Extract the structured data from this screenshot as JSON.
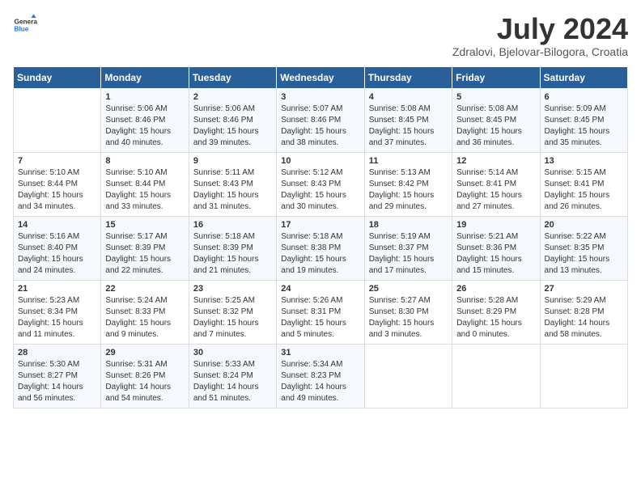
{
  "logo": {
    "text_general": "General",
    "text_blue": "Blue"
  },
  "header": {
    "month": "July 2024",
    "location": "Zdralovi, Bjelovar-Bilogora, Croatia"
  },
  "weekdays": [
    "Sunday",
    "Monday",
    "Tuesday",
    "Wednesday",
    "Thursday",
    "Friday",
    "Saturday"
  ],
  "weeks": [
    [
      {
        "day": "",
        "sunrise": "",
        "sunset": "",
        "daylight": ""
      },
      {
        "day": "1",
        "sunrise": "Sunrise: 5:06 AM",
        "sunset": "Sunset: 8:46 PM",
        "daylight": "Daylight: 15 hours and 40 minutes."
      },
      {
        "day": "2",
        "sunrise": "Sunrise: 5:06 AM",
        "sunset": "Sunset: 8:46 PM",
        "daylight": "Daylight: 15 hours and 39 minutes."
      },
      {
        "day": "3",
        "sunrise": "Sunrise: 5:07 AM",
        "sunset": "Sunset: 8:46 PM",
        "daylight": "Daylight: 15 hours and 38 minutes."
      },
      {
        "day": "4",
        "sunrise": "Sunrise: 5:08 AM",
        "sunset": "Sunset: 8:45 PM",
        "daylight": "Daylight: 15 hours and 37 minutes."
      },
      {
        "day": "5",
        "sunrise": "Sunrise: 5:08 AM",
        "sunset": "Sunset: 8:45 PM",
        "daylight": "Daylight: 15 hours and 36 minutes."
      },
      {
        "day": "6",
        "sunrise": "Sunrise: 5:09 AM",
        "sunset": "Sunset: 8:45 PM",
        "daylight": "Daylight: 15 hours and 35 minutes."
      }
    ],
    [
      {
        "day": "7",
        "sunrise": "Sunrise: 5:10 AM",
        "sunset": "Sunset: 8:44 PM",
        "daylight": "Daylight: 15 hours and 34 minutes."
      },
      {
        "day": "8",
        "sunrise": "Sunrise: 5:10 AM",
        "sunset": "Sunset: 8:44 PM",
        "daylight": "Daylight: 15 hours and 33 minutes."
      },
      {
        "day": "9",
        "sunrise": "Sunrise: 5:11 AM",
        "sunset": "Sunset: 8:43 PM",
        "daylight": "Daylight: 15 hours and 31 minutes."
      },
      {
        "day": "10",
        "sunrise": "Sunrise: 5:12 AM",
        "sunset": "Sunset: 8:43 PM",
        "daylight": "Daylight: 15 hours and 30 minutes."
      },
      {
        "day": "11",
        "sunrise": "Sunrise: 5:13 AM",
        "sunset": "Sunset: 8:42 PM",
        "daylight": "Daylight: 15 hours and 29 minutes."
      },
      {
        "day": "12",
        "sunrise": "Sunrise: 5:14 AM",
        "sunset": "Sunset: 8:41 PM",
        "daylight": "Daylight: 15 hours and 27 minutes."
      },
      {
        "day": "13",
        "sunrise": "Sunrise: 5:15 AM",
        "sunset": "Sunset: 8:41 PM",
        "daylight": "Daylight: 15 hours and 26 minutes."
      }
    ],
    [
      {
        "day": "14",
        "sunrise": "Sunrise: 5:16 AM",
        "sunset": "Sunset: 8:40 PM",
        "daylight": "Daylight: 15 hours and 24 minutes."
      },
      {
        "day": "15",
        "sunrise": "Sunrise: 5:17 AM",
        "sunset": "Sunset: 8:39 PM",
        "daylight": "Daylight: 15 hours and 22 minutes."
      },
      {
        "day": "16",
        "sunrise": "Sunrise: 5:18 AM",
        "sunset": "Sunset: 8:39 PM",
        "daylight": "Daylight: 15 hours and 21 minutes."
      },
      {
        "day": "17",
        "sunrise": "Sunrise: 5:18 AM",
        "sunset": "Sunset: 8:38 PM",
        "daylight": "Daylight: 15 hours and 19 minutes."
      },
      {
        "day": "18",
        "sunrise": "Sunrise: 5:19 AM",
        "sunset": "Sunset: 8:37 PM",
        "daylight": "Daylight: 15 hours and 17 minutes."
      },
      {
        "day": "19",
        "sunrise": "Sunrise: 5:21 AM",
        "sunset": "Sunset: 8:36 PM",
        "daylight": "Daylight: 15 hours and 15 minutes."
      },
      {
        "day": "20",
        "sunrise": "Sunrise: 5:22 AM",
        "sunset": "Sunset: 8:35 PM",
        "daylight": "Daylight: 15 hours and 13 minutes."
      }
    ],
    [
      {
        "day": "21",
        "sunrise": "Sunrise: 5:23 AM",
        "sunset": "Sunset: 8:34 PM",
        "daylight": "Daylight: 15 hours and 11 minutes."
      },
      {
        "day": "22",
        "sunrise": "Sunrise: 5:24 AM",
        "sunset": "Sunset: 8:33 PM",
        "daylight": "Daylight: 15 hours and 9 minutes."
      },
      {
        "day": "23",
        "sunrise": "Sunrise: 5:25 AM",
        "sunset": "Sunset: 8:32 PM",
        "daylight": "Daylight: 15 hours and 7 minutes."
      },
      {
        "day": "24",
        "sunrise": "Sunrise: 5:26 AM",
        "sunset": "Sunset: 8:31 PM",
        "daylight": "Daylight: 15 hours and 5 minutes."
      },
      {
        "day": "25",
        "sunrise": "Sunrise: 5:27 AM",
        "sunset": "Sunset: 8:30 PM",
        "daylight": "Daylight: 15 hours and 3 minutes."
      },
      {
        "day": "26",
        "sunrise": "Sunrise: 5:28 AM",
        "sunset": "Sunset: 8:29 PM",
        "daylight": "Daylight: 15 hours and 0 minutes."
      },
      {
        "day": "27",
        "sunrise": "Sunrise: 5:29 AM",
        "sunset": "Sunset: 8:28 PM",
        "daylight": "Daylight: 14 hours and 58 minutes."
      }
    ],
    [
      {
        "day": "28",
        "sunrise": "Sunrise: 5:30 AM",
        "sunset": "Sunset: 8:27 PM",
        "daylight": "Daylight: 14 hours and 56 minutes."
      },
      {
        "day": "29",
        "sunrise": "Sunrise: 5:31 AM",
        "sunset": "Sunset: 8:26 PM",
        "daylight": "Daylight: 14 hours and 54 minutes."
      },
      {
        "day": "30",
        "sunrise": "Sunrise: 5:33 AM",
        "sunset": "Sunset: 8:24 PM",
        "daylight": "Daylight: 14 hours and 51 minutes."
      },
      {
        "day": "31",
        "sunrise": "Sunrise: 5:34 AM",
        "sunset": "Sunset: 8:23 PM",
        "daylight": "Daylight: 14 hours and 49 minutes."
      },
      {
        "day": "",
        "sunrise": "",
        "sunset": "",
        "daylight": ""
      },
      {
        "day": "",
        "sunrise": "",
        "sunset": "",
        "daylight": ""
      },
      {
        "day": "",
        "sunrise": "",
        "sunset": "",
        "daylight": ""
      }
    ]
  ]
}
